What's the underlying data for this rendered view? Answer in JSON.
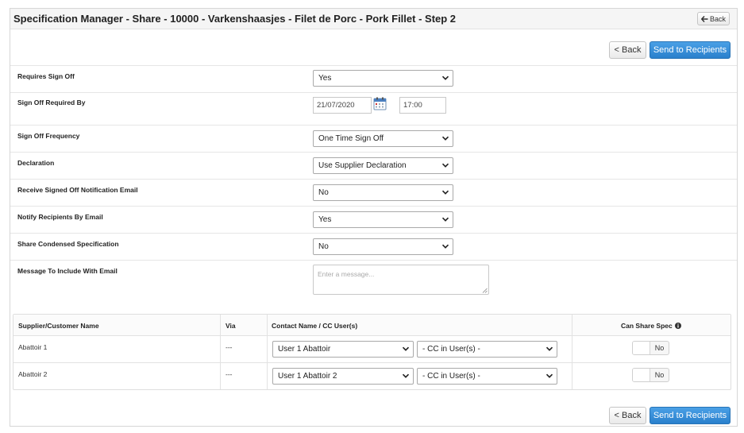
{
  "header": {
    "title": "Specification Manager - Share - 10000 - Varkenshaasjes - Filet de Porc - Pork Fillet - Step 2",
    "back_label": "Back"
  },
  "toolbar": {
    "back_label": "< Back",
    "send_label": "Send to Recipients"
  },
  "form": {
    "requires_sign_off": {
      "label": "Requires Sign Off",
      "value": "Yes"
    },
    "sign_off_required_by": {
      "label": "Sign Off Required By",
      "date": "21/07/2020",
      "time": "17:00"
    },
    "sign_off_frequency": {
      "label": "Sign Off Frequency",
      "value": "One Time Sign Off"
    },
    "declaration": {
      "label": "Declaration",
      "value": "Use Supplier Declaration"
    },
    "receive_notification": {
      "label": "Receive Signed Off Notification Email",
      "value": "No"
    },
    "notify_recipients": {
      "label": "Notify Recipients By Email",
      "value": "Yes"
    },
    "share_condensed": {
      "label": "Share Condensed Specification",
      "value": "No"
    },
    "message": {
      "label": "Message To Include With Email",
      "placeholder": "Enter a message..."
    }
  },
  "table": {
    "columns": [
      "Supplier/Customer Name",
      "Via",
      "Contact Name / CC User(s)",
      "Can Share Spec"
    ],
    "rows": [
      {
        "name": "Abattoir 1",
        "via": "---",
        "contact": "User 1 Abattoir",
        "cc": "- CC in User(s) -",
        "can_share": "No"
      },
      {
        "name": "Abattoir 2",
        "via": "---",
        "contact": "User 1 Abattoir 2",
        "cc": "- CC in User(s) -",
        "can_share": "No"
      }
    ]
  },
  "colors": {
    "primary": "#2a80cc",
    "border": "#d6d6d6"
  },
  "icons": [
    "back-arrow-icon",
    "calendar-icon",
    "chevron-down-icon",
    "info-icon",
    "resize-grip-icon"
  ]
}
